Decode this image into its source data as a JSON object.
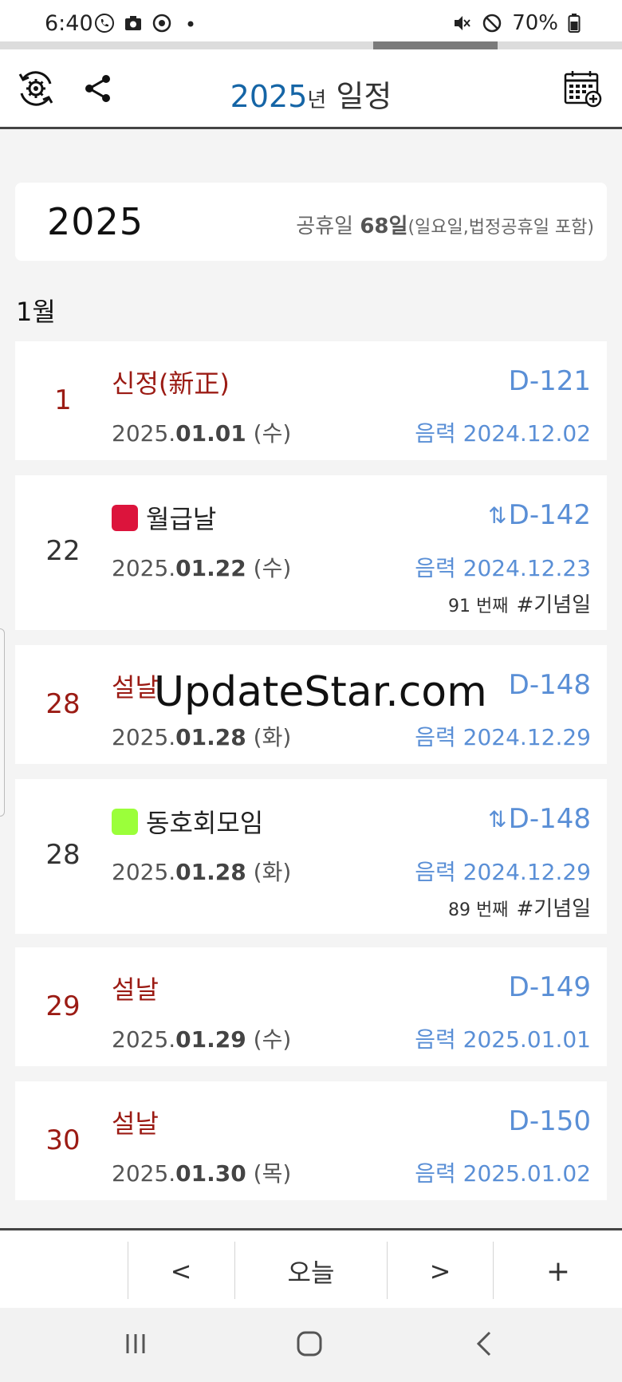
{
  "status": {
    "time": "6:40",
    "battery": "70%"
  },
  "toolbar": {
    "title_year": "2025",
    "title_nyeon": "년",
    "title_rest": " 일정"
  },
  "year_summary": {
    "year": "2025",
    "holiday_label": "공휴일 ",
    "holiday_count": "68일",
    "holiday_note": "(일요일,법정공휴일 포함)"
  },
  "month_label": "1월",
  "events": [
    {
      "day": "1",
      "name": "신정(新正)",
      "date_prefix": "2025.",
      "date_bold": "01.01",
      "date_suffix": " (수)",
      "dday": "D-121",
      "lunar": "음력 2024.12.02"
    },
    {
      "day": "22",
      "name": "월급날",
      "swatch": "#dc143c",
      "date_prefix": "2025.",
      "date_bold": "01.22",
      "date_suffix": " (수)",
      "dday": "D-142",
      "arrows": "⇅",
      "lunar": "음력 2024.12.23",
      "count": "91 번째",
      "tag": "#기념일"
    },
    {
      "day": "28",
      "name": "설날",
      "date_prefix": "2025.",
      "date_bold": "01.28",
      "date_suffix": " (화)",
      "dday": "D-148",
      "lunar": "음력 2024.12.29"
    },
    {
      "day": "28",
      "name": "동호회모임",
      "swatch": "#9bff3a",
      "date_prefix": "2025.",
      "date_bold": "01.28",
      "date_suffix": " (화)",
      "dday": "D-148",
      "arrows": "⇅",
      "lunar": "음력 2024.12.29",
      "count": "89 번째",
      "tag": "#기념일"
    },
    {
      "day": "29",
      "name": "설날",
      "date_prefix": "2025.",
      "date_bold": "01.29",
      "date_suffix": " (수)",
      "dday": "D-149",
      "lunar": "음력 2025.01.01"
    },
    {
      "day": "30",
      "name": "설날",
      "date_prefix": "2025.",
      "date_bold": "01.30",
      "date_suffix": " (목)",
      "dday": "D-150",
      "lunar": "음력 2025.01.02"
    }
  ],
  "watermark": "UpdateStar.com",
  "bottom_nav": {
    "prev": "<",
    "today": "오늘",
    "next": ">",
    "add": "+"
  },
  "colors": {
    "holiday_red": "#9b1b14",
    "dday_blue": "#5a8fd6",
    "year_blue": "#1565a6"
  }
}
